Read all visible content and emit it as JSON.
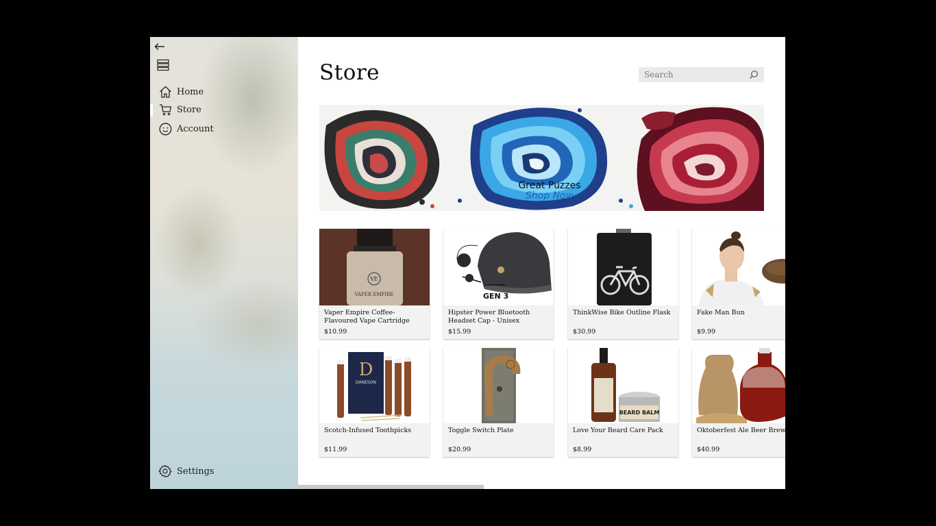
{
  "sidebar": {
    "items": [
      {
        "label": "Home",
        "icon": "home-icon"
      },
      {
        "label": "Store",
        "icon": "cart-icon"
      },
      {
        "label": "Account",
        "icon": "smiley-icon"
      }
    ],
    "settings_label": "Settings"
  },
  "page": {
    "title": "Store"
  },
  "search": {
    "placeholder": "Search"
  },
  "banner": {
    "title": "Great Puzzes",
    "cta": "Shop Now"
  },
  "products": [
    {
      "name": "Vaper Empire Coffee-Flavoured Vape Cartridge",
      "price": "$10.99",
      "image_text": "VAPER EMPIRE"
    },
    {
      "name": "Hipster Power Bluetooth Headset Cap - Unisex",
      "price": "$15.99",
      "image_text": "GEN 3"
    },
    {
      "name": "ThinkWise Bike Outline Flask",
      "price": "$30.99"
    },
    {
      "name": "Fake Man Bun",
      "price": "$9.99"
    },
    {
      "name": "Scotch-Infused Toothpicks",
      "price": "$11.99",
      "image_text": "DANESON"
    },
    {
      "name": "Toggle Switch Plate",
      "price": "$20.99"
    },
    {
      "name": "Love Your Beard Care Pack",
      "price": "$8.99",
      "image_text": "BEARD BALM"
    },
    {
      "name": "Oktoberfest Ale Beer Brewing Kit",
      "price": "$40.99"
    }
  ],
  "colors": {
    "accent": "#1c64b8",
    "card_bg": "#f2f2f2"
  }
}
